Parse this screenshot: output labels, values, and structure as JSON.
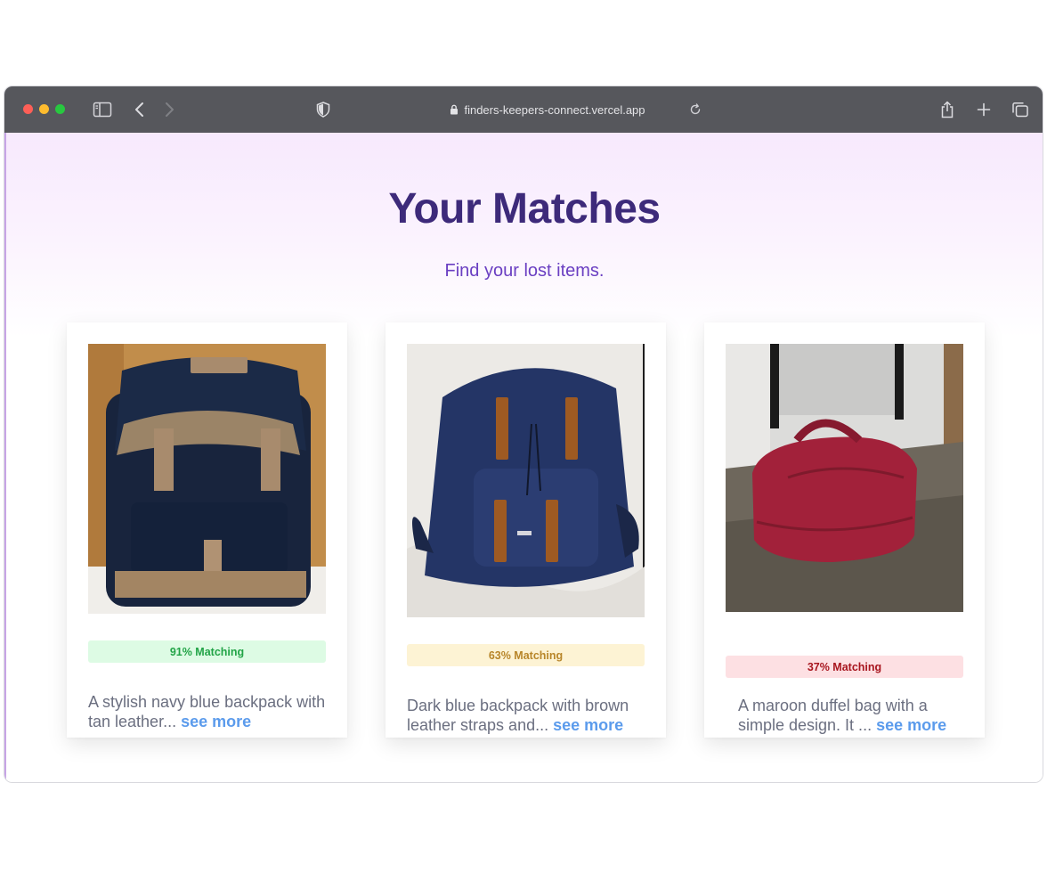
{
  "browser": {
    "url": "finders-keepers-connect.vercel.app"
  },
  "page": {
    "title": "Your Matches",
    "subtitle": "Find your lost items."
  },
  "colors": {
    "title": "#3d2a7a",
    "subtitle": "#6a3fc2",
    "link": "#5b9bec",
    "badge_high_bg": "#ddfbe4",
    "badge_high_text": "#22a447",
    "badge_mid_bg": "#fdf3d4",
    "badge_mid_text": "#b8862a",
    "badge_low_bg": "#fde0e3",
    "badge_low_text": "#a8161f"
  },
  "matches": [
    {
      "image": "navy blue backpack with tan leather flap",
      "match_label": "91% Matching",
      "match_percent": 91,
      "description": " A stylish navy blue backpack with tan leather...",
      "see_more": "see more"
    },
    {
      "image": "dark blue backpack with brown leather straps on a bed sheet",
      "match_label": "63% Matching",
      "match_percent": 63,
      "description": "Dark blue backpack with brown leather straps and...",
      "see_more": "see more"
    },
    {
      "image": "maroon duffel bag on concrete floor",
      "match_label": "37% Matching",
      "match_percent": 37,
      "description": "A maroon duffel bag with a simple design. It ...",
      "see_more": "see more"
    }
  ]
}
